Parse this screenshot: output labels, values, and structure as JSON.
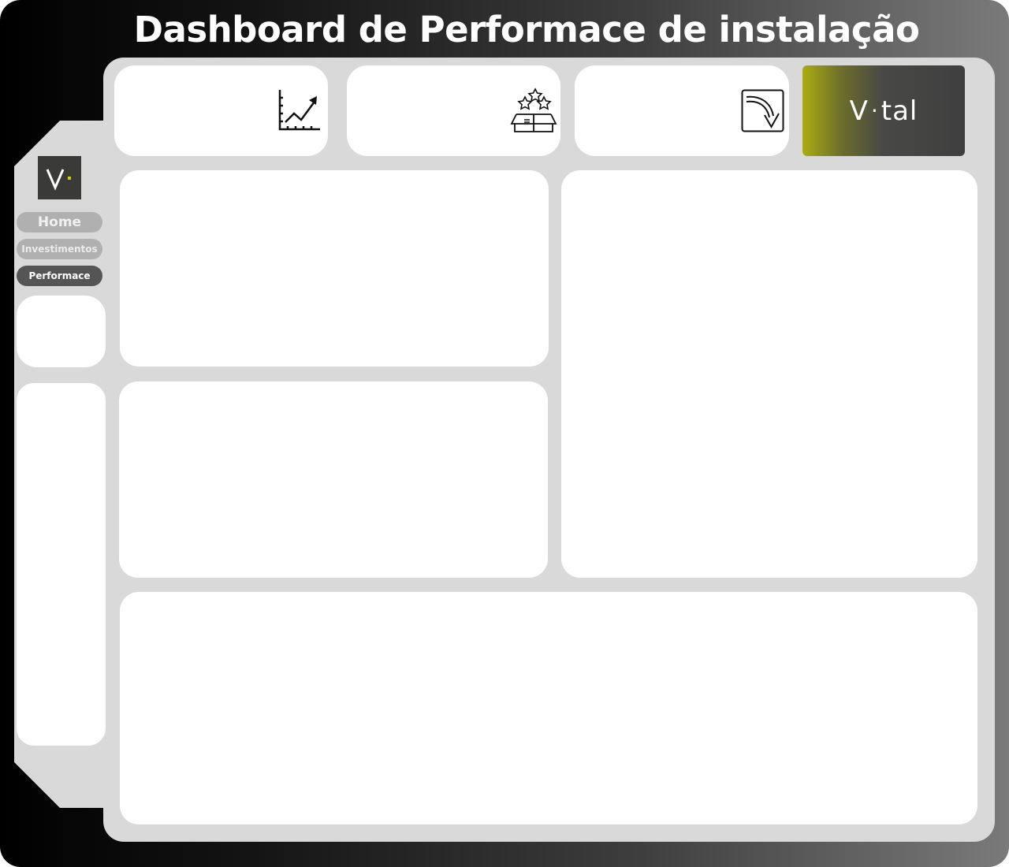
{
  "header": {
    "title": "Dashboard de Performace de instalação"
  },
  "sidebar": {
    "logo": "V·",
    "nav": [
      {
        "label": "Home"
      },
      {
        "label": "Investimentos"
      },
      {
        "label": "Performace"
      }
    ]
  },
  "kpi_icons": [
    "line-chart-growth-icon",
    "product-box-stars-icon",
    "curved-arrow-down-icon"
  ],
  "brand": {
    "wordmark_left": "V",
    "wordmark_dot": "·",
    "wordmark_right": "tal"
  },
  "colors": {
    "accent": "#c8d400",
    "panel": "#d9d9d9",
    "nav_active": "#555555",
    "nav_inactive": "#b0b0b0"
  }
}
